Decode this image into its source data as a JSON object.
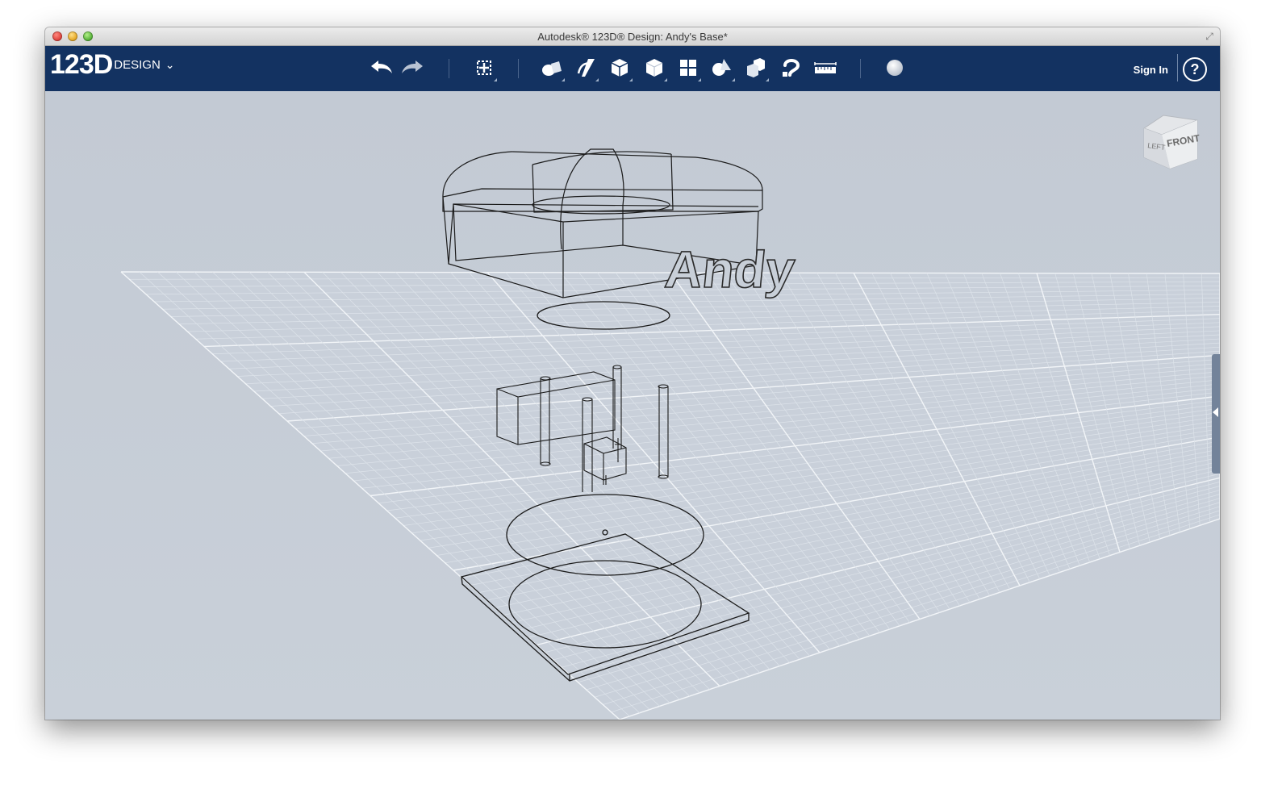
{
  "window": {
    "title": "Autodesk® 123D® Design: Andy's Base*"
  },
  "app": {
    "logo_main": "123D",
    "logo_sub": "DESIGN",
    "logo_caret": "⌄"
  },
  "toolbar": {
    "tools": [
      {
        "name": "undo-icon"
      },
      {
        "name": "redo-icon"
      },
      {
        "name": "transform-icon"
      },
      {
        "name": "primitives-icon"
      },
      {
        "name": "sketch-icon"
      },
      {
        "name": "construct-icon"
      },
      {
        "name": "modify-icon"
      },
      {
        "name": "pattern-icon"
      },
      {
        "name": "grouping-icon"
      },
      {
        "name": "combine-icon"
      },
      {
        "name": "snap-icon"
      },
      {
        "name": "measure-icon"
      },
      {
        "name": "material-icon"
      }
    ],
    "sign_in": "Sign In",
    "help": "?"
  },
  "viewcube": {
    "left_label": "LEFT",
    "front_label": "FRONT"
  },
  "scene": {
    "text_object": "Andy"
  },
  "colors": {
    "toolbar_bg": "#133261",
    "viewport_bg": "#c5ccd6",
    "grid_line": "#e2e7ee",
    "wireframe": "#1b1b1b"
  }
}
